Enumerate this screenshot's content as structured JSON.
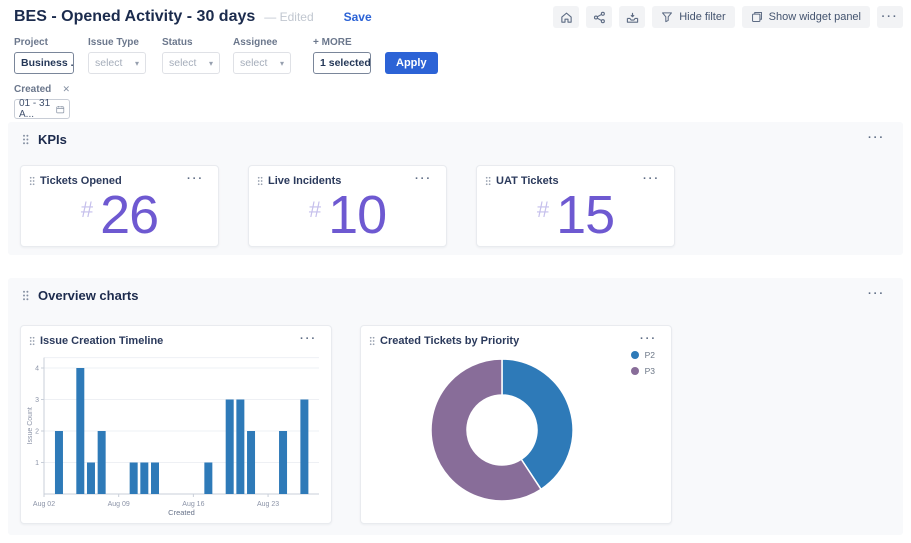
{
  "ui": {
    "ellipsis": "···"
  },
  "header": {
    "title": "BES - Opened Activity - 30 days",
    "edited_label": "— Edited",
    "save_label": "Save",
    "toolbar": {
      "hide_filter_label": "Hide filter",
      "show_widget_panel_label": "Show widget panel"
    }
  },
  "filters": {
    "project": {
      "label": "Project",
      "value": "Business ..."
    },
    "issue_type": {
      "label": "Issue Type",
      "placeholder": "select"
    },
    "status": {
      "label": "Status",
      "placeholder": "select"
    },
    "assignee": {
      "label": "Assignee",
      "placeholder": "select"
    },
    "more": {
      "label": "+ MORE",
      "value": "1 selected"
    },
    "apply_label": "Apply",
    "created": {
      "label": "Created",
      "value": "01 - 31 A..."
    }
  },
  "kpi_section": {
    "title": "KPIs",
    "cards": [
      {
        "title": "Tickets Opened",
        "prefix": "#",
        "value": "26"
      },
      {
        "title": "Live Incidents",
        "prefix": "#",
        "value": "10"
      },
      {
        "title": "UAT Tickets",
        "prefix": "#",
        "value": "15"
      }
    ]
  },
  "charts_section": {
    "title": "Overview charts"
  },
  "colors": {
    "accent_blue": "#2c63d6",
    "kpi_purple": "#6e59d1",
    "bar_blue": "#2e7ab8",
    "donut_purple": "#886d99"
  },
  "chart_data": [
    {
      "type": "bar",
      "title": "Issue Creation Timeline",
      "xlabel": "Created",
      "ylabel": "Issue Count",
      "categories": [
        "Aug 03",
        "Aug 05",
        "Aug 06",
        "Aug 07",
        "Aug 10",
        "Aug 11",
        "Aug 12",
        "Aug 17",
        "Aug 19",
        "Aug 20",
        "Aug 21",
        "Aug 24",
        "Aug 26"
      ],
      "values": [
        2,
        4,
        1,
        2,
        1,
        1,
        1,
        1,
        3,
        3,
        2,
        2,
        3
      ],
      "day_offsets": [
        1,
        3,
        4,
        5,
        8,
        9,
        10,
        15,
        17,
        18,
        19,
        22,
        24
      ],
      "x_tick_labels": [
        "Aug 02",
        "Aug 09",
        "Aug 16",
        "Aug 23"
      ],
      "x_tick_day_offsets": [
        0,
        7,
        14,
        21
      ],
      "y_ticks": [
        1,
        2,
        3,
        4
      ],
      "ylim": [
        0,
        4.33
      ],
      "grid": true,
      "legend": false,
      "bar_color": "#2e7ab8"
    },
    {
      "type": "donut",
      "title": "Created Tickets by Priority",
      "legend_position": "top-right",
      "segments": [
        {
          "label": "P2",
          "value": 11,
          "color": "#2e7ab8"
        },
        {
          "label": "P3",
          "value": 16,
          "color": "#886d99"
        }
      ]
    }
  ]
}
